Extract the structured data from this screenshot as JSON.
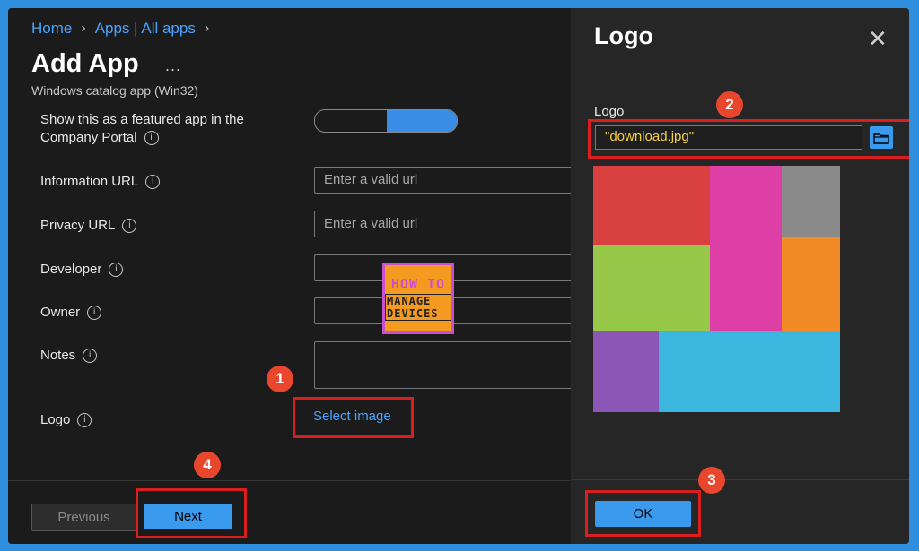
{
  "breadcrumb": {
    "home": "Home",
    "apps": "Apps | All apps"
  },
  "page": {
    "title": "Add App",
    "more": "...",
    "subtitle": "Windows catalog app (Win32)"
  },
  "form": {
    "featured_label_line1": "Show this as a featured app in the",
    "featured_label_line2": "Company Portal",
    "info_url_label": "Information URL",
    "info_url_placeholder": "Enter a valid url",
    "privacy_url_label": "Privacy URL",
    "privacy_url_placeholder": "Enter a valid url",
    "developer_label": "Developer",
    "owner_label": "Owner",
    "notes_label": "Notes",
    "logo_label": "Logo",
    "select_image": "Select image",
    "info_glyph": "i"
  },
  "footer": {
    "previous": "Previous",
    "next": "Next"
  },
  "panel": {
    "title": "Logo",
    "close": "✕",
    "logo_label": "Logo",
    "file_value": "\"download.jpg\"",
    "ok": "OK"
  },
  "badges": {
    "b1": "1",
    "b2": "2",
    "b3": "3",
    "b4": "4"
  },
  "watermark": {
    "line1": "HOW TO",
    "line2": "MANAGE DEVICES"
  },
  "colors": {
    "accent": "#3a9bee",
    "annotation": "#d81e1e"
  }
}
